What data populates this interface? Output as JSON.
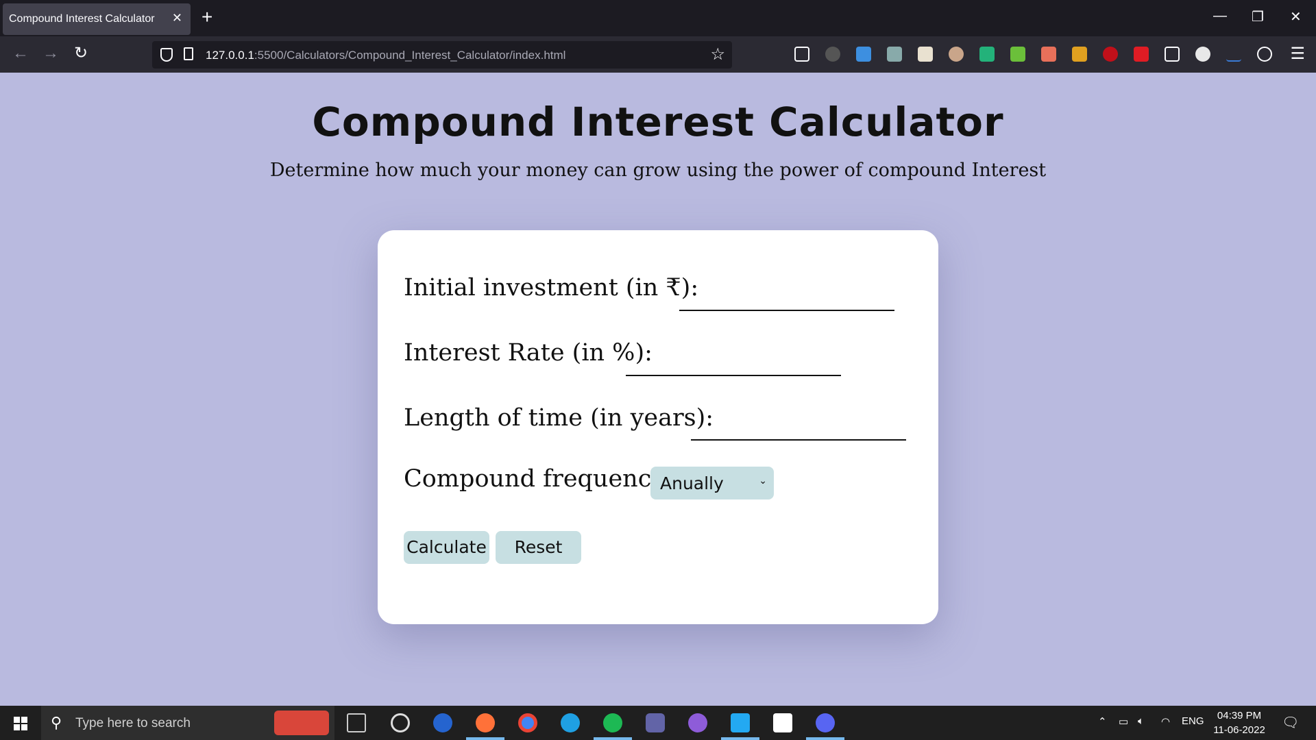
{
  "browser": {
    "tab_title": "Compound Interest Calculator",
    "tab_close": "✕",
    "new_tab": "+",
    "url_host": "127.0.0.1",
    "url_rest": ":5500/Calculators/Compound_Interest_Calculator/index.html"
  },
  "page": {
    "title": "Compound Interest Calculator",
    "subtitle": "Determine how much your money can grow using the power of compound Interest"
  },
  "form": {
    "initial_label": "Initial investment (in ₹):",
    "initial_value": "",
    "rate_label": "Interest Rate (in %):",
    "rate_value": "",
    "time_label": "Length of time (in years):",
    "time_value": "",
    "frequency_label": "Compound frequency:",
    "frequency_selected": "Anually",
    "calculate_label": "Calculate",
    "reset_label": "Reset"
  },
  "taskbar": {
    "search_placeholder": "Type here to search",
    "language": "ENG",
    "time": "04:39 PM",
    "date": "11-06-2022"
  },
  "colors": {
    "page_bg": "#b9badf",
    "card_bg": "#ffffff",
    "control_bg": "#c7dfe2"
  }
}
